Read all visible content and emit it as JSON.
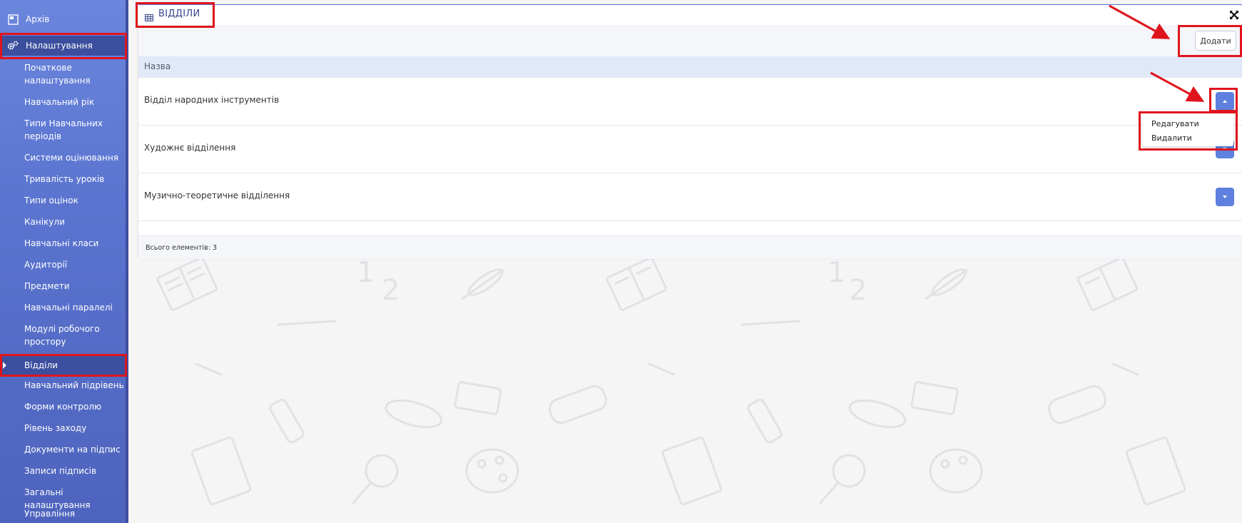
{
  "sidebar": {
    "top_items": [
      {
        "label": "Архів",
        "icon": "archive-icon"
      },
      {
        "label": "Налаштування",
        "icon": "gears-icon"
      }
    ],
    "sub_items": [
      {
        "label": "Початкове налаштування"
      },
      {
        "label": "Навчальний рік"
      },
      {
        "label": "Типи Навчальних періодів"
      },
      {
        "label": "Системи оцінювання"
      },
      {
        "label": "Тривалість уроків"
      },
      {
        "label": "Типи оцінок"
      },
      {
        "label": "Канікули"
      },
      {
        "label": "Навчальні класи"
      },
      {
        "label": "Аудиторії"
      },
      {
        "label": "Предмети"
      },
      {
        "label": "Навчальні паралелі"
      },
      {
        "label": "Модулі робочого простору"
      },
      {
        "label": "Відділи",
        "active": true
      },
      {
        "label": "Навчальний підрівень"
      },
      {
        "label": "Форми контролю"
      },
      {
        "label": "Рівень заходу"
      },
      {
        "label": "Документи на підпис"
      },
      {
        "label": "Записи підписів"
      },
      {
        "label": "Загальні налаштування"
      },
      {
        "label": "Управління доступами"
      }
    ]
  },
  "panel": {
    "title": "ВІДДІЛИ",
    "add_label": "Додати",
    "column_name": "Назва",
    "rows": [
      {
        "name": "Відділ народних інструментів"
      },
      {
        "name": "Художнє відділення"
      },
      {
        "name": "Музично-теоретичне відділення"
      }
    ],
    "footer": "Всього елементів: 3"
  },
  "dropdown": {
    "items": [
      "Редагувати",
      "Видалити"
    ]
  },
  "colors": {
    "sidebar": "#5a74cf",
    "accent_button": "#5e80de",
    "highlight": "#e0141c"
  }
}
